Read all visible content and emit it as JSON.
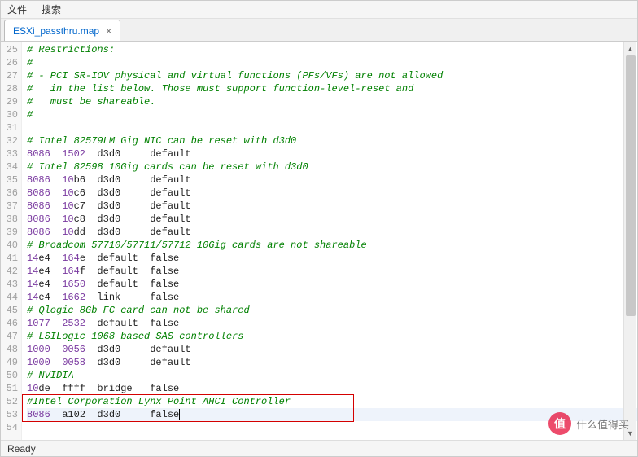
{
  "menu": {
    "file": "文件",
    "search": "搜索"
  },
  "tab": {
    "title": "ESXi_passthru.map",
    "close": "×"
  },
  "lines": [
    {
      "n": 25,
      "segs": [
        {
          "c": "cmt",
          "t": "# Restrictions:"
        }
      ]
    },
    {
      "n": 26,
      "segs": [
        {
          "c": "cmt",
          "t": "#"
        }
      ]
    },
    {
      "n": 27,
      "segs": [
        {
          "c": "cmt",
          "t": "# - PCI SR-IOV physical and virtual functions (PFs/VFs) are not allowed"
        }
      ]
    },
    {
      "n": 28,
      "segs": [
        {
          "c": "cmt",
          "t": "#   in the list below. Those must support function-level-reset and"
        }
      ]
    },
    {
      "n": 29,
      "segs": [
        {
          "c": "cmt",
          "t": "#   must be shareable."
        }
      ]
    },
    {
      "n": 30,
      "segs": [
        {
          "c": "cmt",
          "t": "#"
        }
      ]
    },
    {
      "n": 31,
      "segs": [
        {
          "c": "txt",
          "t": ""
        }
      ]
    },
    {
      "n": 32,
      "segs": [
        {
          "c": "cmt",
          "t": "# Intel 82579LM Gig NIC can be reset with d3d0"
        }
      ]
    },
    {
      "n": 33,
      "segs": [
        {
          "c": "num",
          "t": "8086  1502"
        },
        {
          "c": "txt",
          "t": "  d3d0     default"
        }
      ]
    },
    {
      "n": 34,
      "segs": [
        {
          "c": "cmt",
          "t": "# Intel 82598 10Gig cards can be reset with d3d0"
        }
      ]
    },
    {
      "n": 35,
      "segs": [
        {
          "c": "num",
          "t": "8086  10"
        },
        {
          "c": "txt",
          "t": "b6  d3d0     default"
        }
      ]
    },
    {
      "n": 36,
      "segs": [
        {
          "c": "num",
          "t": "8086  10"
        },
        {
          "c": "txt",
          "t": "c6  d3d0     default"
        }
      ]
    },
    {
      "n": 37,
      "segs": [
        {
          "c": "num",
          "t": "8086  10"
        },
        {
          "c": "txt",
          "t": "c7  d3d0     default"
        }
      ]
    },
    {
      "n": 38,
      "segs": [
        {
          "c": "num",
          "t": "8086  10"
        },
        {
          "c": "txt",
          "t": "c8  d3d0     default"
        }
      ]
    },
    {
      "n": 39,
      "segs": [
        {
          "c": "num",
          "t": "8086  10"
        },
        {
          "c": "txt",
          "t": "dd  d3d0     default"
        }
      ]
    },
    {
      "n": 40,
      "segs": [
        {
          "c": "cmt",
          "t": "# Broadcom 57710/57711/57712 10Gig cards are not shareable"
        }
      ]
    },
    {
      "n": 41,
      "segs": [
        {
          "c": "num",
          "t": "14"
        },
        {
          "c": "txt",
          "t": "e4  "
        },
        {
          "c": "num",
          "t": "164"
        },
        {
          "c": "txt",
          "t": "e  default  false"
        }
      ]
    },
    {
      "n": 42,
      "segs": [
        {
          "c": "num",
          "t": "14"
        },
        {
          "c": "txt",
          "t": "e4  "
        },
        {
          "c": "num",
          "t": "164"
        },
        {
          "c": "txt",
          "t": "f  default  false"
        }
      ]
    },
    {
      "n": 43,
      "segs": [
        {
          "c": "num",
          "t": "14"
        },
        {
          "c": "txt",
          "t": "e4  "
        },
        {
          "c": "num",
          "t": "1650"
        },
        {
          "c": "txt",
          "t": "  default  false"
        }
      ]
    },
    {
      "n": 44,
      "segs": [
        {
          "c": "num",
          "t": "14"
        },
        {
          "c": "txt",
          "t": "e4  "
        },
        {
          "c": "num",
          "t": "1662"
        },
        {
          "c": "txt",
          "t": "  link     false"
        }
      ]
    },
    {
      "n": 45,
      "segs": [
        {
          "c": "cmt",
          "t": "# Qlogic 8Gb FC card can not be shared"
        }
      ]
    },
    {
      "n": 46,
      "segs": [
        {
          "c": "num",
          "t": "1077  2532"
        },
        {
          "c": "txt",
          "t": "  default  false"
        }
      ]
    },
    {
      "n": 47,
      "segs": [
        {
          "c": "cmt",
          "t": "# LSILogic 1068 based SAS controllers"
        }
      ]
    },
    {
      "n": 48,
      "segs": [
        {
          "c": "num",
          "t": "1000  0056"
        },
        {
          "c": "txt",
          "t": "  d3d0     default"
        }
      ]
    },
    {
      "n": 49,
      "segs": [
        {
          "c": "num",
          "t": "1000  0058"
        },
        {
          "c": "txt",
          "t": "  d3d0     default"
        }
      ]
    },
    {
      "n": 50,
      "segs": [
        {
          "c": "cmt",
          "t": "# NVIDIA"
        }
      ]
    },
    {
      "n": 51,
      "segs": [
        {
          "c": "num",
          "t": "10"
        },
        {
          "c": "txt",
          "t": "de  ffff  bridge   false"
        }
      ]
    },
    {
      "n": 52,
      "segs": [
        {
          "c": "cmt",
          "t": "#Intel Corporation Lynx Point AHCI Controller"
        }
      ]
    },
    {
      "n": 53,
      "cur": true,
      "caret": true,
      "segs": [
        {
          "c": "num",
          "t": "8086"
        },
        {
          "c": "txt",
          "t": "  a102  d3d0     false"
        }
      ]
    },
    {
      "n": 54,
      "segs": [
        {
          "c": "txt",
          "t": ""
        }
      ]
    }
  ],
  "status": {
    "text": "Ready"
  },
  "watermark": {
    "icon": "值",
    "text": "什么值得买"
  },
  "scroll": {
    "up": "▲",
    "down": "▼"
  }
}
